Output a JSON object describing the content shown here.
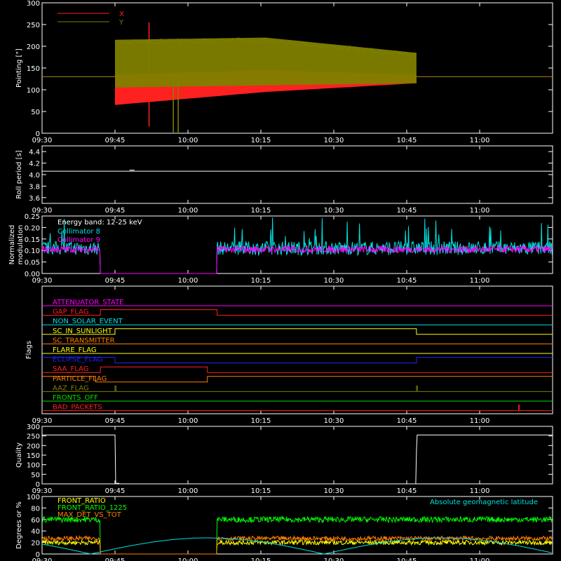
{
  "figure": {
    "background": "#000000",
    "axis_color": "#ffffff"
  },
  "time_axis": {
    "start": "09:30",
    "end": "11:15",
    "ticks": [
      "09:30",
      "09:45",
      "10:00",
      "10:15",
      "10:30",
      "10:45",
      "11:00"
    ]
  },
  "chart_data": [
    {
      "type": "line",
      "title": "",
      "ylabel": "Pointing [\"]",
      "ylim": [
        0,
        300
      ],
      "yticks": [
        "0",
        "50",
        "100",
        "150",
        "200",
        "250",
        "300"
      ],
      "legend_position": "top-left",
      "series": [
        {
          "name": "X",
          "color": "#ff2020",
          "baseline": 130,
          "band_start": "09:45",
          "band_end": "10:47",
          "band_low": [
            65,
            95,
            115
          ],
          "band_high": [
            135,
            145,
            135
          ],
          "spikes": [
            {
              "time": "09:52",
              "value": 255
            },
            {
              "time": "09:52",
              "value": 15
            }
          ]
        },
        {
          "name": "Y",
          "color": "#808000",
          "baseline": 130,
          "band_start": "09:45",
          "band_end": "10:47",
          "band_low": [
            105,
            110,
            115
          ],
          "band_high": [
            215,
            220,
            185
          ],
          "spikes": [
            {
              "time": "09:57",
              "value": 0
            },
            {
              "time": "09:58",
              "value": 0
            }
          ]
        }
      ]
    },
    {
      "type": "line",
      "ylabel": "Roll period [s]",
      "ylim": [
        3.5,
        4.5
      ],
      "yticks": [
        "3.6",
        "3.8",
        "4.0",
        "4.2",
        "4.4"
      ],
      "series": [
        {
          "name": "",
          "color": "#ffffff",
          "value": 4.06
        }
      ]
    },
    {
      "type": "line",
      "ylabel": "Normalized modulation",
      "ylabel_lines": [
        "Normalized",
        "modulation"
      ],
      "ylim": [
        0,
        0.25
      ],
      "yticks": [
        "0.00",
        "0.05",
        "0.10",
        "0.15",
        "0.20",
        "0.25"
      ],
      "annotation": "Energy band: 12-25 keV",
      "legend_position": "top-left",
      "series": [
        {
          "name": "Collimator 8",
          "color": "#00e0e0",
          "mean": 0.11,
          "noise": 0.03,
          "gaps": [
            [
              "09:42",
              "10:06"
            ]
          ]
        },
        {
          "name": "Collimator 9",
          "color": "#ff00ff",
          "mean": 0.105,
          "noise": 0.015,
          "gaps": [
            [
              "09:42",
              "10:06"
            ]
          ]
        }
      ]
    },
    {
      "type": "flags",
      "ylabel": "Flags",
      "flags": [
        {
          "name": "ATTENUATOR_STATE",
          "color": "#ff00ff",
          "on": []
        },
        {
          "name": "GAP_FLAG",
          "color": "#ff2020",
          "on": [
            [
              "09:42",
              "10:06"
            ]
          ]
        },
        {
          "name": "NON_SOLAR_EVENT",
          "color": "#00e0e0",
          "on": []
        },
        {
          "name": "SC_IN_SUNLIGHT",
          "color": "#ffff00",
          "on": [
            [
              "09:45",
              "10:47"
            ]
          ]
        },
        {
          "name": "SC_TRANSMITTER",
          "color": "#ff8000",
          "on": []
        },
        {
          "name": "FLARE_FLAG",
          "color": "#ffff00",
          "on": []
        },
        {
          "name": "ECLIPSE_FLAG",
          "color": "#2020ff",
          "on": [
            [
              "09:30",
              "09:45"
            ],
            [
              "10:47",
              "11:15"
            ]
          ]
        },
        {
          "name": "SAA_FLAG",
          "color": "#ff2020",
          "on": [
            [
              "09:42",
              "10:04"
            ]
          ]
        },
        {
          "name": "PARTICLE_FLAG",
          "color": "#ff8000",
          "on": [
            [
              "09:30",
              "09:41"
            ],
            [
              "10:04",
              "11:15"
            ]
          ]
        },
        {
          "name": "AAZ_FLAG",
          "color": "#808000",
          "on": [
            [
              "09:45",
              "09:45.2"
            ],
            [
              "10:47",
              "10:47.2"
            ]
          ]
        },
        {
          "name": "FRONTS_OFF",
          "color": "#00e000",
          "on": []
        },
        {
          "name": "BAD_PACKETS",
          "color": "#ff2020",
          "on": [
            [
              "11:08",
              "11:08.2"
            ]
          ]
        }
      ]
    },
    {
      "type": "line",
      "ylabel": "Quality",
      "ylim": [
        0,
        300
      ],
      "yticks": [
        "0",
        "50",
        "100",
        "150",
        "200",
        "250",
        "300"
      ],
      "series": [
        {
          "name": "",
          "color": "#ffffff",
          "high": 255,
          "low": 0,
          "low_start": "09:45",
          "low_end": "10:47"
        }
      ]
    },
    {
      "type": "line",
      "ylabel": "Degrees or %",
      "ylim": [
        0,
        100
      ],
      "yticks": [
        "0",
        "20",
        "40",
        "60",
        "80",
        "100"
      ],
      "legend_position": "top-left",
      "annotation_right": "Absolute geomagnetic latitude",
      "annotation_right_color": "#00e0e0",
      "series": [
        {
          "name": "FRONT_RATIO",
          "color": "#ffff00",
          "mean": 20,
          "noise": 4,
          "gaps": [
            [
              "09:42",
              "10:06"
            ]
          ]
        },
        {
          "name": "FRONT_RATIO_1225",
          "color": "#00ff00",
          "mean": 60,
          "noise": 5,
          "gaps": [
            [
              "09:42",
              "10:06"
            ]
          ]
        },
        {
          "name": "MAX_DET_VS_TOT",
          "color": "#ff8000",
          "mean": 27,
          "noise": 4,
          "gaps": [
            [
              "09:42",
              "10:06"
            ]
          ]
        },
        {
          "name": "Absolute geomagnetic latitude",
          "color": "#00e0e0",
          "amplitude": 28,
          "period_minutes": 48,
          "phase_minutes": 10
        }
      ]
    }
  ]
}
